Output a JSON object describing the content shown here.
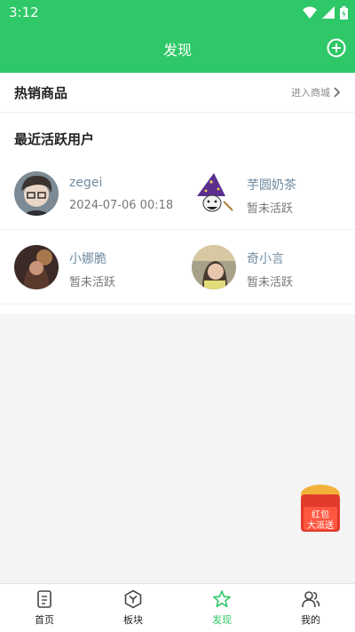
{
  "status": {
    "time": "3:12"
  },
  "appbar": {
    "title": "发现",
    "add_icon": "plus-circle-icon"
  },
  "hot": {
    "label": "热销商品",
    "more": "进入商城"
  },
  "recent": {
    "title": "最近活跃用户",
    "users": [
      {
        "name": "zegei",
        "info": "2024-07-06 00:18"
      },
      {
        "name": "芋圆奶茶",
        "info": "暂未活跃"
      },
      {
        "name": "小娜脆",
        "info": "暂未活跃"
      },
      {
        "name": "奇小言",
        "info": "暂未活跃"
      }
    ]
  },
  "floating": {
    "badge_line1": "红包",
    "badge_line2": "大派送"
  },
  "tabs": [
    {
      "label": "首页",
      "icon": "document-icon"
    },
    {
      "label": "板块",
      "icon": "hexagon-y-icon"
    },
    {
      "label": "发现",
      "icon": "star-icon"
    },
    {
      "label": "我的",
      "icon": "users-icon"
    }
  ],
  "colors": {
    "brand": "#2fc868",
    "tab_active": "#2fc868"
  }
}
